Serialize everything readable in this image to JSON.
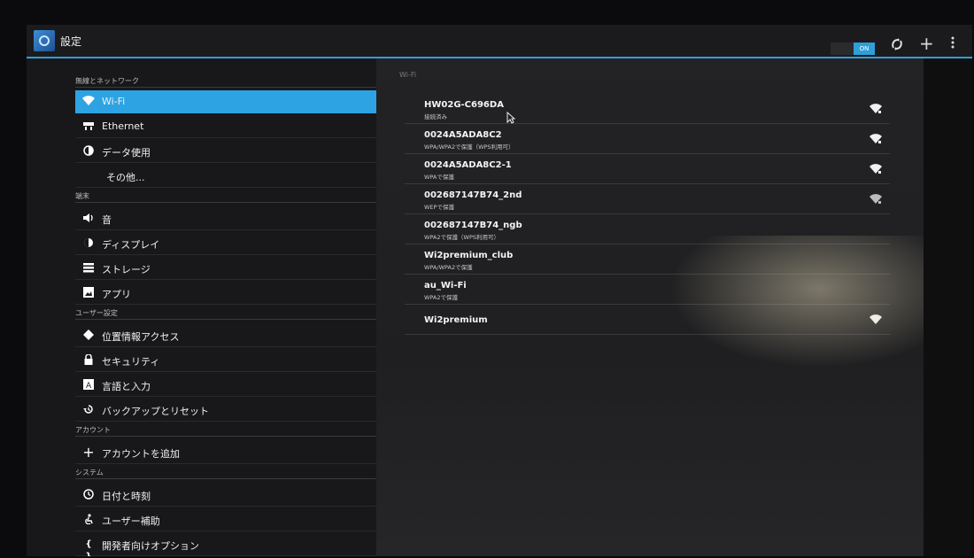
{
  "actionbar": {
    "title": "設定",
    "toggle_state": "ON",
    "icons": [
      "settings-app-icon",
      "wps-icon",
      "add-network-icon",
      "overflow-menu-icon"
    ]
  },
  "sidebar": {
    "headers": [
      "無線とネットワーク",
      "端末",
      "ユーザー設定",
      "アカウント",
      "システム"
    ],
    "items": [
      {
        "label": "Wi-Fi",
        "icon": "wifi-icon",
        "selected": true
      },
      {
        "label": "Ethernet",
        "icon": "ethernet-icon"
      },
      {
        "label": "データ使用",
        "icon": "data-usage-icon"
      },
      {
        "label": "その他...",
        "icon": ""
      },
      {
        "label": "音",
        "icon": "sound-icon"
      },
      {
        "label": "ディスプレイ",
        "icon": "display-icon"
      },
      {
        "label": "ストレージ",
        "icon": "storage-icon"
      },
      {
        "label": "アプリ",
        "icon": "apps-icon"
      },
      {
        "label": "位置情報アクセス",
        "icon": "location-icon"
      },
      {
        "label": "セキュリティ",
        "icon": "lock-icon"
      },
      {
        "label": "言語と入力",
        "icon": "language-icon"
      },
      {
        "label": "バックアップとリセット",
        "icon": "backup-icon"
      },
      {
        "label": "アカウントを追加",
        "icon": "add-icon"
      },
      {
        "label": "日付と時刻",
        "icon": "clock-icon"
      },
      {
        "label": "ユーザー補助",
        "icon": "accessibility-icon"
      },
      {
        "label": "開発者向けオプション",
        "icon": "developer-icon"
      }
    ]
  },
  "wifi": {
    "section_label": "Wi-Fi",
    "networks": [
      {
        "ssid": "HW02G-C696DA",
        "status": "接続済み"
      },
      {
        "ssid": "0024A5ADA8C2",
        "status": "WPA/WPA2で保護（WPS利用可）"
      },
      {
        "ssid": "0024A5ADA8C2-1",
        "status": "WPAで保護"
      },
      {
        "ssid": "002687147B74_2nd",
        "status": "WEPで保護"
      },
      {
        "ssid": "002687147B74_ngb",
        "status": "WPA2で保護（WPS利用可）"
      },
      {
        "ssid": "Wi2premium_club",
        "status": "WPA/WPA2で保護"
      },
      {
        "ssid": "au_Wi-Fi",
        "status": "WPA2で保護"
      },
      {
        "ssid": "Wi2premium",
        "status": ""
      }
    ]
  },
  "colors": {
    "accent": "#2ea3e3",
    "background": "#141416"
  }
}
